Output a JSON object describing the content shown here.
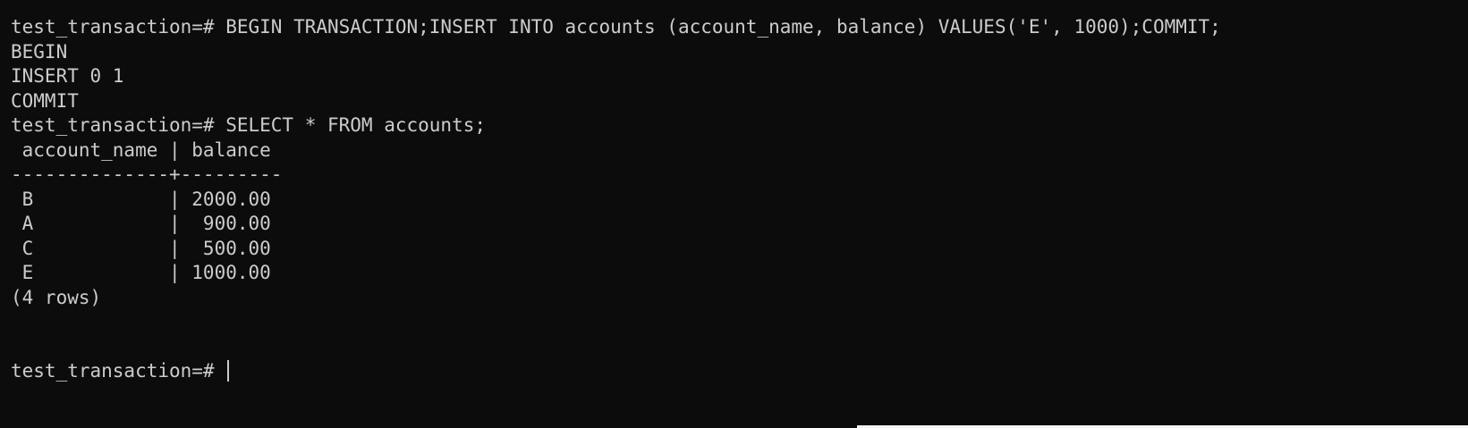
{
  "terminal": {
    "lines": [
      "test_transaction=# BEGIN TRANSACTION;INSERT INTO accounts (account_name, balance) VALUES('E', 1000);COMMIT;",
      "BEGIN",
      "INSERT 0 1",
      "COMMIT",
      "test_transaction=# SELECT * FROM accounts;",
      " account_name | balance",
      "--------------+---------",
      " B            | 2000.00",
      " A            |  900.00",
      " C            |  500.00",
      " E            | 1000.00",
      "(4 rows)",
      "",
      "",
      "test_transaction=# "
    ],
    "table": {
      "columns": [
        "account_name",
        "balance"
      ],
      "rows": [
        [
          "B",
          "2000.00"
        ],
        [
          "A",
          "900.00"
        ],
        [
          "C",
          "500.00"
        ],
        [
          "E",
          "1000.00"
        ]
      ]
    },
    "colors": {
      "background": "#0c0c0c",
      "foreground": "#cccccc"
    }
  }
}
